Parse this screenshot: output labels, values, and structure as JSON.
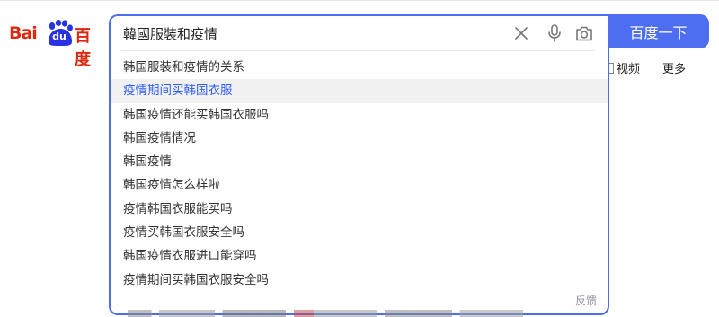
{
  "logo": {
    "text_latin": "Bai",
    "text_du": "du",
    "text_cn": "百度"
  },
  "search": {
    "query": "韓國服裝和疫情",
    "submit_label": "百度一下",
    "suggestions": [
      "韩国服装和疫情的关系",
      "疫情期间买韩国衣服",
      "韩国疫情还能买韩国衣服吗",
      "韩国疫情情况",
      "韩国疫情",
      "韩国疫情怎么样啦",
      "疫情韩国衣服能买吗",
      "疫情买韩国衣服安全吗",
      "韩国疫情衣服进口能穿吗",
      "疫情期间买韩国衣服安全吗"
    ],
    "active_index": 1,
    "feedback_label": "反馈"
  },
  "nav": {
    "video_label": "视频",
    "more_label": "更多"
  },
  "colors": {
    "accent": "#4e6ef2",
    "brand_red": "#de2910",
    "active_link": "#315efb"
  },
  "icons": [
    "close-icon",
    "microphone-icon",
    "camera-icon",
    "baidu-paw-icon"
  ]
}
